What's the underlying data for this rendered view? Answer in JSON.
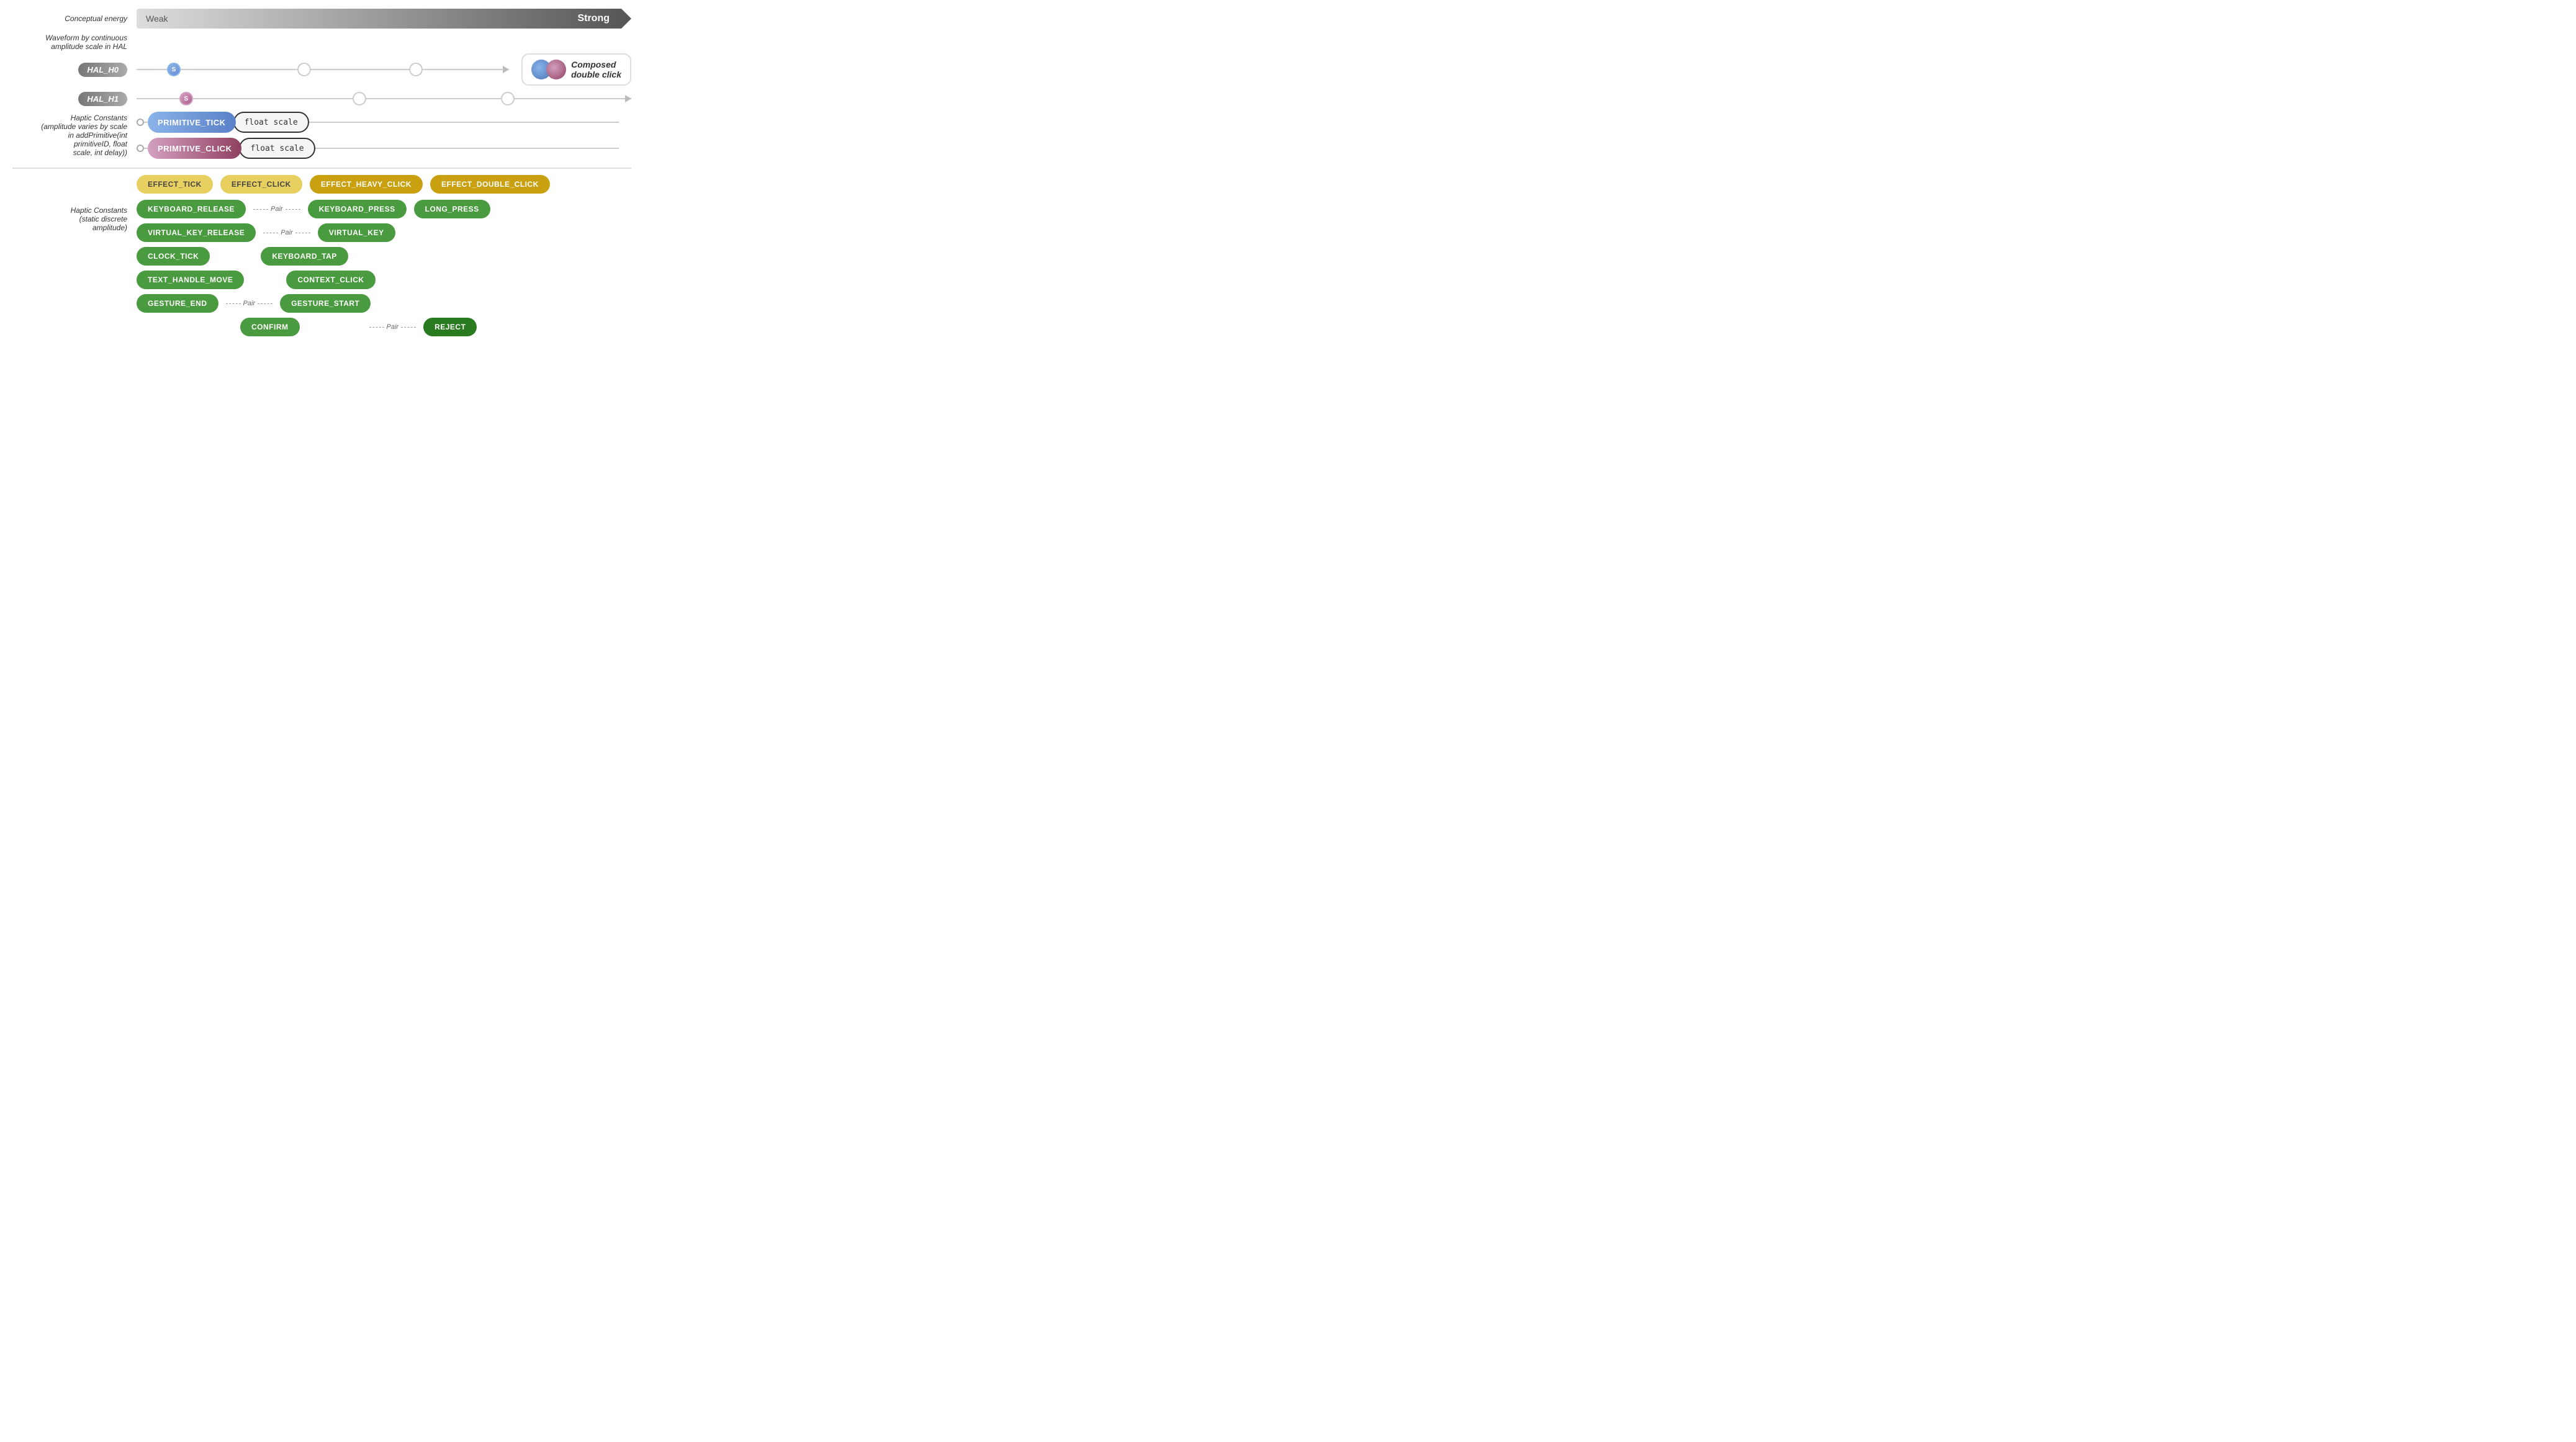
{
  "energy": {
    "label": "Conceptual energy",
    "weak": "Weak",
    "strong": "Strong"
  },
  "waveform": {
    "label": "Waveform by continuous\namplitude scale in HAL"
  },
  "hal": {
    "h0": {
      "label": "HAL_H0",
      "start": "S",
      "circles": [
        "",
        ""
      ]
    },
    "h1": {
      "label": "HAL_H1",
      "start": "S",
      "circles": [
        "",
        ""
      ]
    }
  },
  "composed": {
    "text": "Composed\ndouble click"
  },
  "haptic_constants_label": "Haptic Constants\n(amplitude varies by scale\nin addPrimitive(int\nprimitiveID, float\nscale, int delay))",
  "primitives": [
    {
      "id": "tick",
      "left": "PRIMITIVE_TICK",
      "right": "float scale"
    },
    {
      "id": "click",
      "left": "PRIMITIVE_CLICK",
      "right": "float scale"
    }
  ],
  "effects_top": [
    {
      "id": "effect_tick",
      "label": "EFFECT_TICK",
      "style": "yellow"
    },
    {
      "id": "effect_click",
      "label": "EFFECT_CLICK",
      "style": "yellow"
    },
    {
      "id": "effect_heavy_click",
      "label": "EFFECT_HEAVY_CLICK",
      "style": "yellow_dark"
    },
    {
      "id": "effect_double_click",
      "label": "EFFECT_DOUBLE_CLICK",
      "style": "yellow_dark"
    }
  ],
  "haptic_constants_discrete_label": "Haptic Constants\n(static discrete\namplitude)",
  "discrete_effects": {
    "col1": [
      {
        "id": "keyboard_release",
        "label": "KEYBOARD_RELEASE",
        "style": "green"
      },
      {
        "id": "virtual_key_release",
        "label": "VIRTUAL_KEY_RELEASE",
        "style": "green"
      },
      {
        "id": "clock_tick",
        "label": "CLOCK_TICK",
        "style": "green"
      },
      {
        "id": "text_handle_move",
        "label": "TEXT_HANDLE_MOVE",
        "style": "green"
      },
      {
        "id": "gesture_end",
        "label": "GESTURE_END",
        "style": "green"
      }
    ],
    "col2": [
      {
        "id": "keyboard_press",
        "label": "KEYBOARD_PRESS",
        "style": "green",
        "pair": true
      },
      {
        "id": "virtual_key",
        "label": "VIRTUAL_KEY",
        "style": "green",
        "pair": true
      },
      {
        "id": "keyboard_tap",
        "label": "KEYBOARD_TAP",
        "style": "green"
      },
      {
        "id": "context_click",
        "label": "CONTEXT_CLICK",
        "style": "green"
      },
      {
        "id": "gesture_start",
        "label": "GESTURE_START",
        "style": "green",
        "pair": true
      }
    ],
    "col3": [
      {
        "id": "long_press",
        "label": "LONG_PRESS",
        "style": "green"
      }
    ],
    "col4": [
      {
        "id": "confirm",
        "label": "CONFIRM",
        "style": "green"
      },
      {
        "id": "reject",
        "label": "REJECT",
        "style": "green_dark"
      }
    ],
    "pair_label": "Pair",
    "pair_label2": "Pair",
    "pair_label3": "Pair",
    "pair_label4": "Pair"
  }
}
